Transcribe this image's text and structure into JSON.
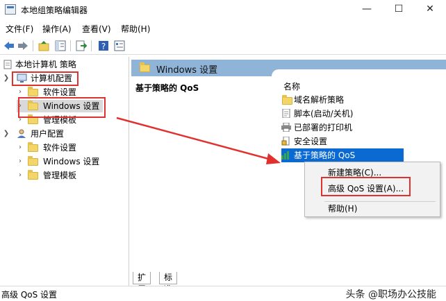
{
  "window": {
    "title": "本地组策略编辑器",
    "minimize_glyph": "—",
    "maximize_glyph": "☐",
    "close_glyph": "✕"
  },
  "menu": {
    "file": "文件(F)",
    "action": "操作(A)",
    "view": "查看(V)",
    "help": "帮助(H)"
  },
  "toolbar": {
    "icons": [
      "back-icon",
      "forward-icon",
      "up-folder-icon",
      "show-tree-icon",
      "export-icon",
      "help-icon",
      "properties-icon"
    ]
  },
  "tree": {
    "root": "本地计算机 策略",
    "computer_config": "计算机配置",
    "cc_software": "软件设置",
    "cc_windows": "Windows 设置",
    "cc_admin": "管理模板",
    "user_config": "用户配置",
    "uc_software": "软件设置",
    "uc_windows": "Windows 设置",
    "uc_admin": "管理模板"
  },
  "details": {
    "header": "Windows 设置",
    "description_title": "基于策略的 QoS",
    "column_name": "名称",
    "items": [
      {
        "label": "域名解析策略",
        "icon": "folder-icon"
      },
      {
        "label": "脚本(启动/关机)",
        "icon": "script-icon"
      },
      {
        "label": "已部署的打印机",
        "icon": "printer-icon"
      },
      {
        "label": "安全设置",
        "icon": "security-icon"
      },
      {
        "label": "基于策略的 QoS",
        "icon": "qos-chart-icon"
      }
    ]
  },
  "context_menu": {
    "new_policy": "新建策略(C)...",
    "advanced_qos": "高级 QoS 设置(A)...",
    "help": "帮助(H)"
  },
  "tabs": {
    "extended": "扩展",
    "standard": "标准"
  },
  "status": {
    "text": "高级 QoS 设置"
  },
  "watermark": {
    "text": "头条 @职场办公技能"
  },
  "colors": {
    "highlight": "#e0312f",
    "selection": "#0a6ad1",
    "header": "#8fb4d8"
  }
}
